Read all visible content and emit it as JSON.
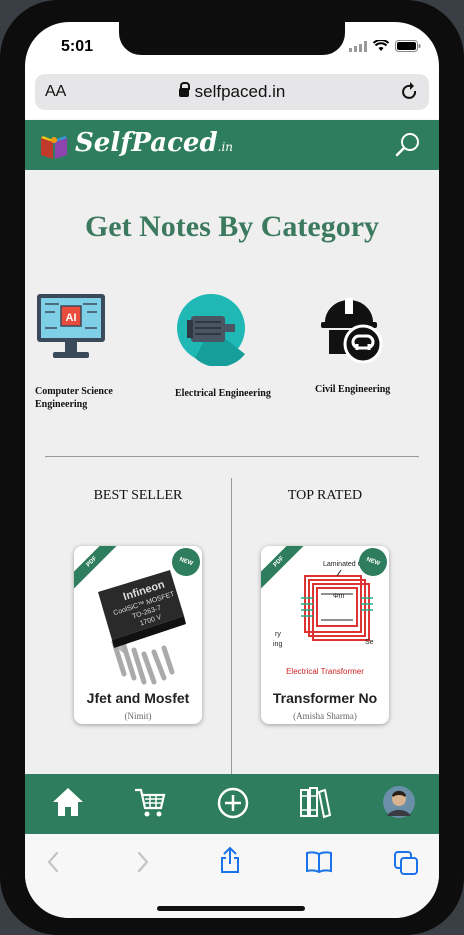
{
  "status": {
    "time": "5:01"
  },
  "browser": {
    "text_size": "AA",
    "url": "selfpaced.in"
  },
  "topnav": {
    "logo_text": "SelfPaced",
    "logo_suffix": ".in"
  },
  "main": {
    "heading": "Get Notes By Category",
    "categories": [
      {
        "label": "Computer Science Engineering",
        "icon": "ai-monitor-icon"
      },
      {
        "label": "Electrical Engineering",
        "icon": "electric-motor-icon"
      },
      {
        "label": "Civil Engineering",
        "icon": "hard-hat-icon"
      }
    ],
    "best_seller": {
      "title": "BEST SELLER",
      "card": {
        "ribbon": "PDF",
        "badge": "NEW",
        "title": "Jfet and Mosfet",
        "author": "(Nimit)",
        "image_text": [
          "Infineon",
          "CoolSiC™ MOSFET",
          "TO-263-7",
          "1700 V"
        ]
      }
    },
    "top_rated": {
      "title": "TOP RATED",
      "card": {
        "ribbon": "PDF",
        "badge": "NEW",
        "title": "Transformer No",
        "author": "(Amisha Sharma)",
        "image_text": [
          "Laminated Co",
          "Φm",
          "ry",
          "ing",
          "Se",
          "Electrical Transformer"
        ]
      }
    }
  },
  "bottomnav": {
    "items": [
      "home-icon",
      "cart-icon",
      "add-icon",
      "books-icon",
      "avatar"
    ]
  },
  "colors": {
    "brand": "#2e7d5e",
    "heading": "#3c7a5f",
    "background": "#efefef"
  }
}
